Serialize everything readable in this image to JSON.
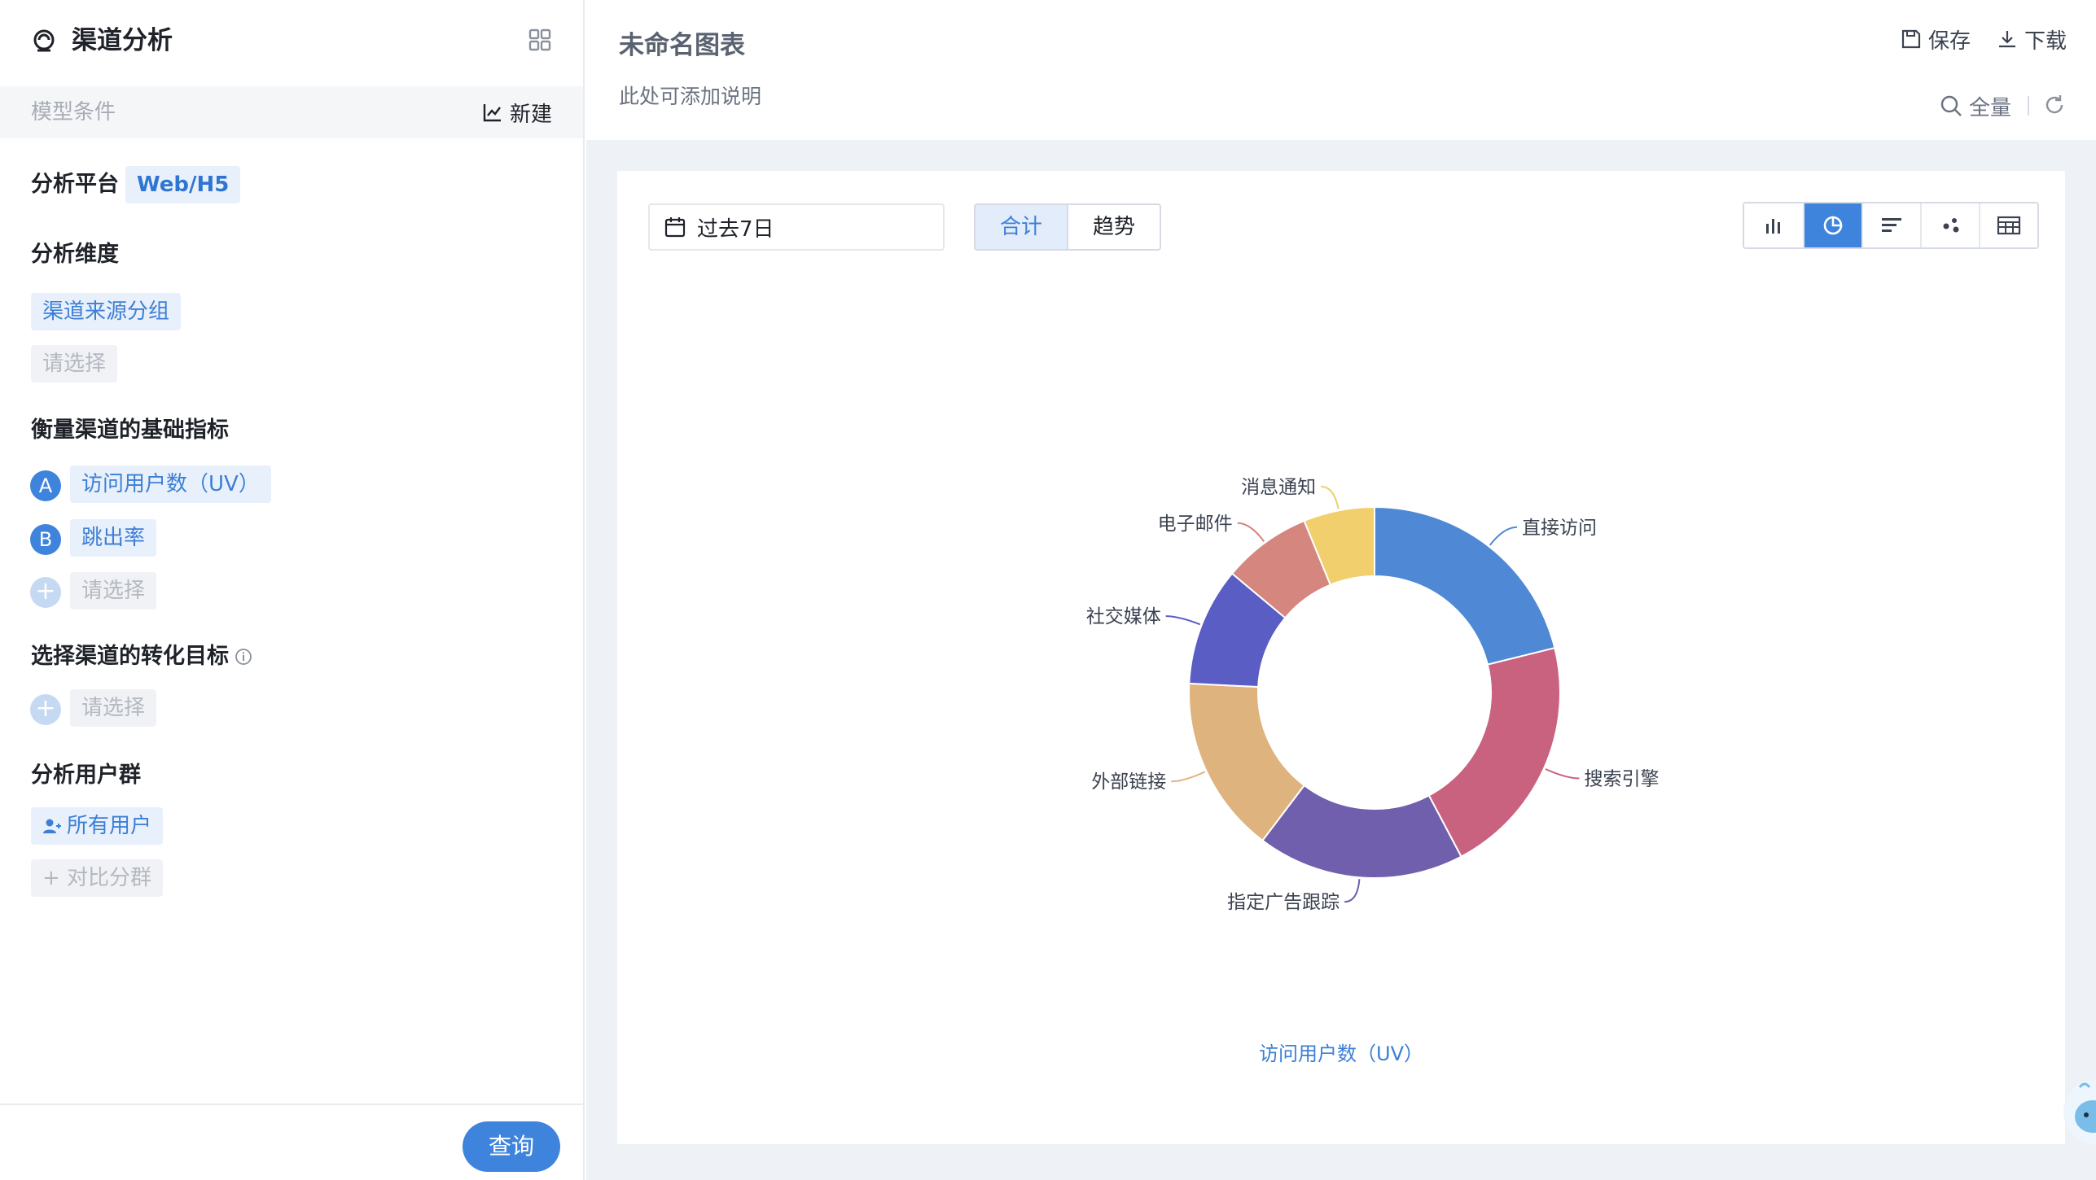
{
  "sidebar": {
    "title": "渠道分析",
    "model_label": "模型条件",
    "new_label": "新建",
    "platform": {
      "label": "分析平台",
      "value": "Web/H5"
    },
    "dimension": {
      "label": "分析维度",
      "selected": "渠道来源分组",
      "placeholder": "请选择"
    },
    "metrics": {
      "label": "衡量渠道的基础指标",
      "items": [
        {
          "letter": "A",
          "name": "访问用户数（UV）"
        },
        {
          "letter": "B",
          "name": "跳出率"
        }
      ],
      "placeholder": "请选择"
    },
    "goal": {
      "label": "选择渠道的转化目标",
      "placeholder": "请选择"
    },
    "users": {
      "label": "分析用户群",
      "selected": "所有用户",
      "compare": "+ 对比分群"
    },
    "query_button": "查询"
  },
  "header": {
    "chart_title": "未命名图表",
    "description": "此处可添加说明",
    "save": "保存",
    "download": "下载",
    "full": "全量"
  },
  "toolbar": {
    "date_range": "过去7日",
    "mode_total": "合计",
    "mode_trend": "趋势",
    "chart_types": [
      "bar-chart-icon",
      "pie-chart-icon",
      "horizontal-bar-icon",
      "scatter-icon",
      "table-icon"
    ],
    "active_type": "pie-chart-icon"
  },
  "chart_data": {
    "type": "pie",
    "donut": true,
    "title": "",
    "footer_label": "访问用户数（UV）",
    "series": [
      {
        "name": "直接访问",
        "value": 20.5,
        "color": "#4f89d6"
      },
      {
        "name": "搜索引擎",
        "value": 20.5,
        "color": "#c9627f"
      },
      {
        "name": "指定广告跟踪",
        "value": 17.5,
        "color": "#6f5fad"
      },
      {
        "name": "外部链接",
        "value": 15.0,
        "color": "#dfb37e"
      },
      {
        "name": "社交媒体",
        "value": 10.0,
        "color": "#5a5dc3"
      },
      {
        "name": "电子邮件",
        "value": 7.5,
        "color": "#d4867f"
      },
      {
        "name": "消息通知",
        "value": 6.0,
        "color": "#f0cf6c"
      }
    ]
  },
  "colors": {
    "accent": "#3f84dc",
    "tag_bg": "#e8f0fb",
    "tag_text": "#3d7fd6"
  }
}
